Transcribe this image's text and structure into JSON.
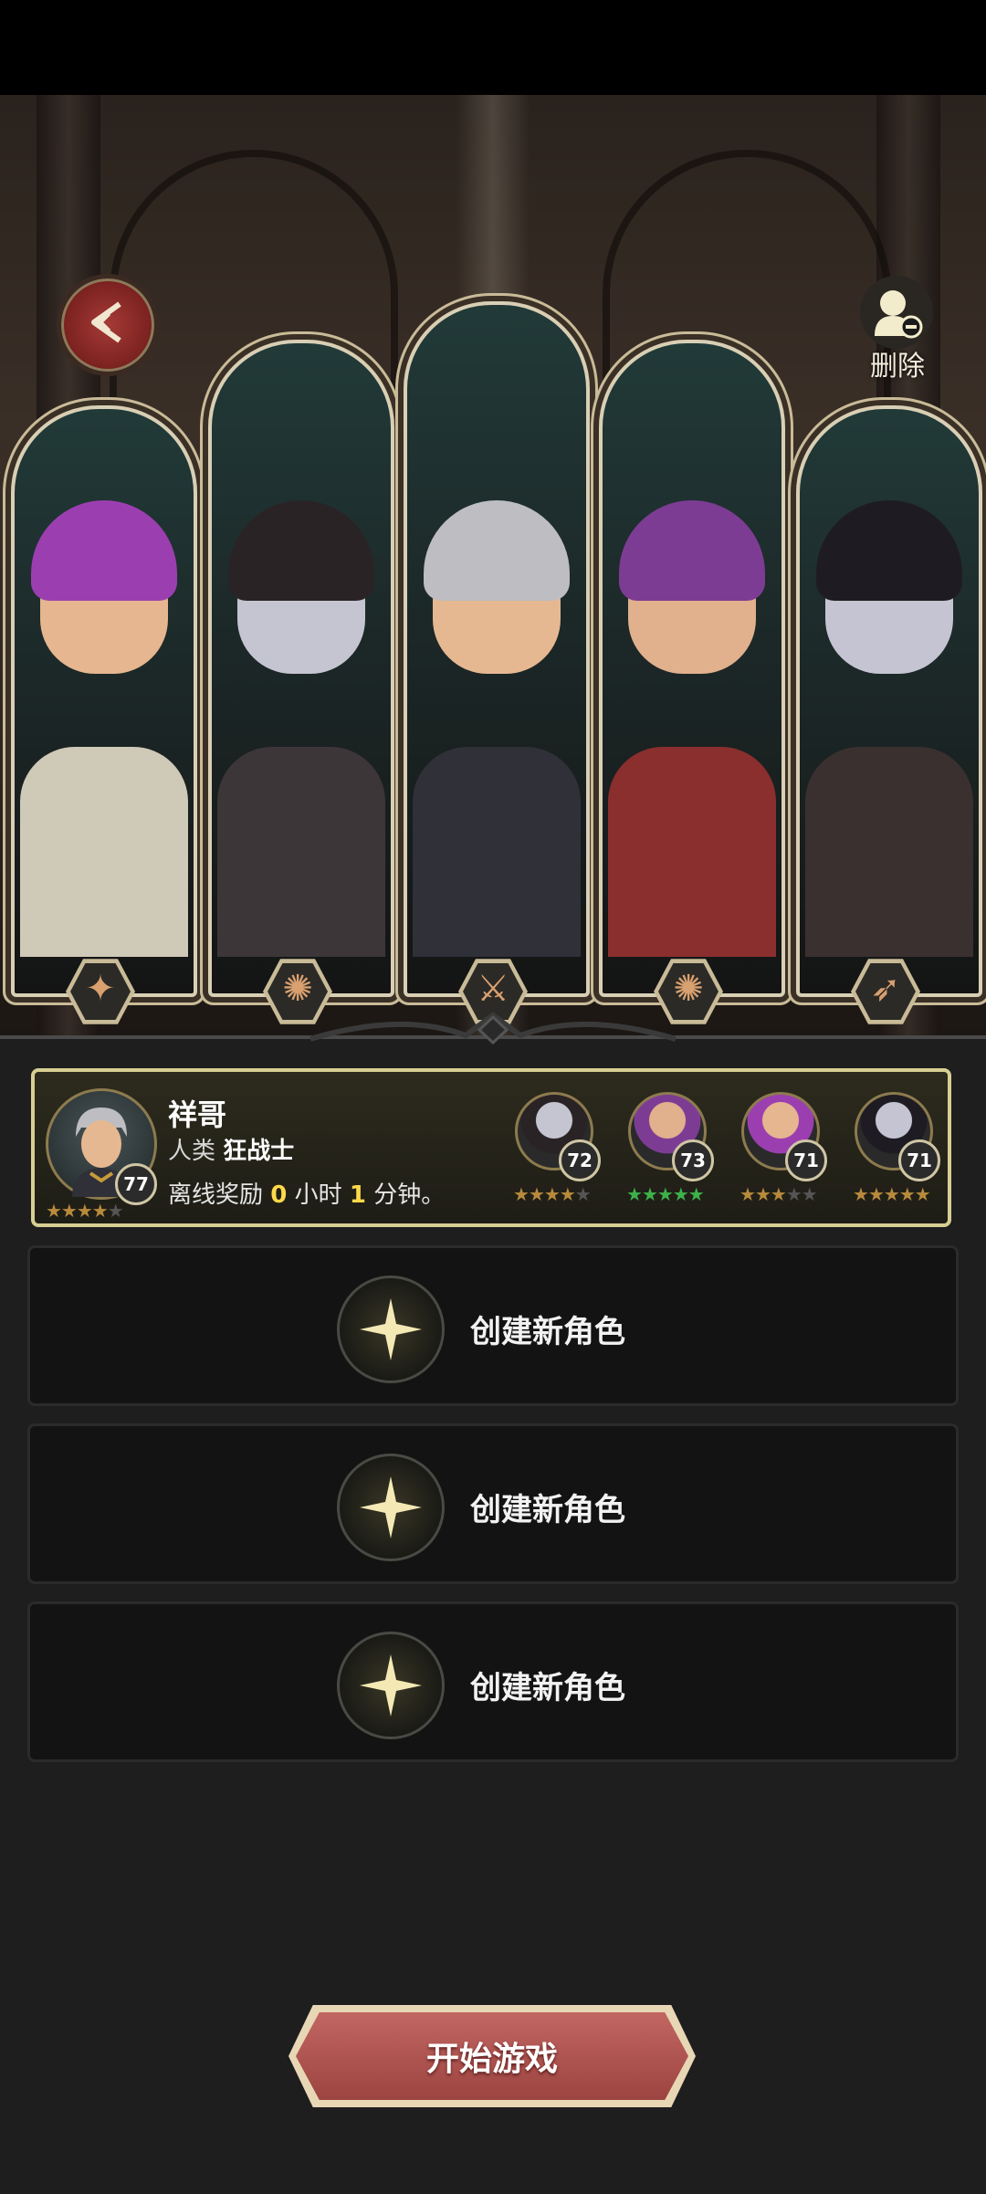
{
  "header": {
    "delete_label": "删除"
  },
  "heroes": [
    {
      "hair": "#9b3fb0",
      "skin": "#e5b68f",
      "body": "#cfc9b8",
      "weapon_icon": "shield-icon",
      "glyph": "✦"
    },
    {
      "hair": "#2a2325",
      "skin": "#c5c5d2",
      "body": "#3c3638",
      "weapon_icon": "staff-icon",
      "glyph": "✺"
    },
    {
      "hair": "#bdbdc2",
      "skin": "#e6b892",
      "body": "#2f3038",
      "weapon_icon": "sword-icon",
      "glyph": "⚔"
    },
    {
      "hair": "#7d3c94",
      "skin": "#e1b08c",
      "body": "#8a2e2e",
      "weapon_icon": "staff-icon",
      "glyph": "✺"
    },
    {
      "hair": "#1e1c22",
      "skin": "#c4c4d2",
      "body": "#3a3030",
      "weapon_icon": "bow-icon",
      "glyph": "➶"
    }
  ],
  "selected_slot": {
    "name": "祥哥",
    "race": "人类",
    "class": "狂战士",
    "level": "77",
    "offline_prefix": "离线奖励",
    "hours": "0",
    "hours_unit": "小时",
    "minutes": "1",
    "minutes_unit": "分钟。",
    "stars": 4,
    "team": [
      {
        "level": "72",
        "stars": 4,
        "star_color": "gold"
      },
      {
        "level": "73",
        "stars": 5,
        "star_color": "green"
      },
      {
        "level": "71",
        "stars": 3,
        "star_color": "gold"
      },
      {
        "level": "71",
        "stars": 5,
        "star_color": "gold"
      }
    ]
  },
  "empty_slots": [
    {
      "label": "创建新角色"
    },
    {
      "label": "创建新角色"
    },
    {
      "label": "创建新角色"
    }
  ],
  "start_button": {
    "label": "开始游戏"
  },
  "colors": {
    "accent_gold": "#d7cf92",
    "start_red": "#b15652",
    "offline_number": "#ffd94a"
  }
}
